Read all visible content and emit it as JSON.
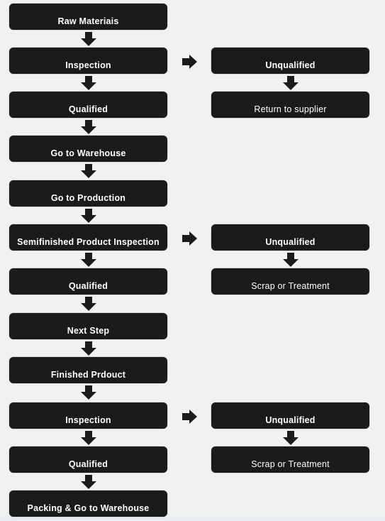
{
  "diagram": {
    "type": "flowchart",
    "colors": {
      "box": "#1b1b1b",
      "text": "#ffffff",
      "arrow": "#1b1b1b",
      "background": "#f1f1f1"
    },
    "main_flow": [
      {
        "label": "Raw Materiais"
      },
      {
        "label": "Inspection"
      },
      {
        "label": "Qualified"
      },
      {
        "label": "Go to Warehouse"
      },
      {
        "label": "Go to Production"
      },
      {
        "label": "Semifinished Product Inspection"
      },
      {
        "label": "Qualified"
      },
      {
        "label": "Next Step"
      },
      {
        "label": "Finished Prdouct"
      },
      {
        "label": "Inspection"
      },
      {
        "label": "Qualified"
      },
      {
        "label": "Packing & Go to Warehouse"
      }
    ],
    "branches": [
      {
        "from_step": 1,
        "unqualified": "Unqualified",
        "result": "Return to supplier"
      },
      {
        "from_step": 5,
        "unqualified": "Unqualified",
        "result": "Scrap or Treatment"
      },
      {
        "from_step": 9,
        "unqualified": "Unqualified",
        "result": "Scrap or Treatment"
      }
    ]
  }
}
